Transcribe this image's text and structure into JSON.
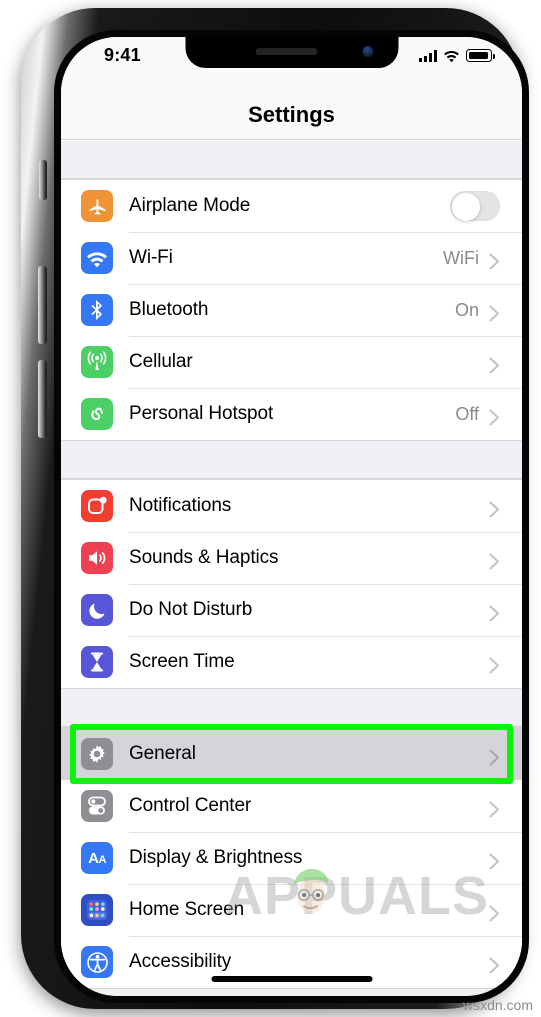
{
  "status_bar": {
    "time": "9:41",
    "signal_icon": "cellular-bars-icon",
    "wifi_icon": "wifi-icon",
    "battery_icon": "battery-full-icon"
  },
  "nav": {
    "title": "Settings"
  },
  "groups": [
    {
      "id": "connectivity",
      "rows": [
        {
          "label": "Airplane Mode",
          "value": "",
          "icon": "airplane-icon",
          "color": "#f09336",
          "accessory": "toggle",
          "toggle_on": false
        },
        {
          "label": "Wi-Fi",
          "value": "WiFi",
          "icon": "wifi-icon",
          "color": "#3478f6",
          "accessory": "chevron"
        },
        {
          "label": "Bluetooth",
          "value": "On",
          "icon": "bluetooth-icon",
          "color": "#3478f6",
          "accessory": "chevron"
        },
        {
          "label": "Cellular",
          "value": "",
          "icon": "cellular-antenna-icon",
          "color": "#4cd066",
          "accessory": "chevron"
        },
        {
          "label": "Personal Hotspot",
          "value": "Off",
          "icon": "hotspot-icon",
          "color": "#4cd066",
          "accessory": "chevron"
        }
      ]
    },
    {
      "id": "alerts",
      "rows": [
        {
          "label": "Notifications",
          "value": "",
          "icon": "notifications-icon",
          "color": "#f03e30",
          "accessory": "chevron"
        },
        {
          "label": "Sounds & Haptics",
          "value": "",
          "icon": "sounds-icon",
          "color": "#f04152",
          "accessory": "chevron"
        },
        {
          "label": "Do Not Disturb",
          "value": "",
          "icon": "moon-icon",
          "color": "#5656d6",
          "accessory": "chevron"
        },
        {
          "label": "Screen Time",
          "value": "",
          "icon": "hourglass-icon",
          "color": "#5656d6",
          "accessory": "chevron"
        }
      ]
    },
    {
      "id": "system",
      "rows": [
        {
          "label": "General",
          "value": "",
          "icon": "gear-icon",
          "color": "#8e8e93",
          "accessory": "chevron",
          "highlighted": true
        },
        {
          "label": "Control Center",
          "value": "",
          "icon": "control-center-icon",
          "color": "#8e8e93",
          "accessory": "chevron"
        },
        {
          "label": "Display & Brightness",
          "value": "",
          "icon": "display-brightness-icon",
          "color": "#3478f6",
          "accessory": "chevron"
        },
        {
          "label": "Home Screen",
          "value": "",
          "icon": "home-screen-icon",
          "color": "#2e4fc4",
          "accessory": "chevron"
        },
        {
          "label": "Accessibility",
          "value": "",
          "icon": "accessibility-icon",
          "color": "#3478f6",
          "accessory": "chevron"
        }
      ]
    }
  ],
  "annotation": {
    "highlight_color": "#0bf20b",
    "highlight_target": "General"
  },
  "watermarks": {
    "brand": "APPUALS",
    "source": "wsxdn.com"
  }
}
